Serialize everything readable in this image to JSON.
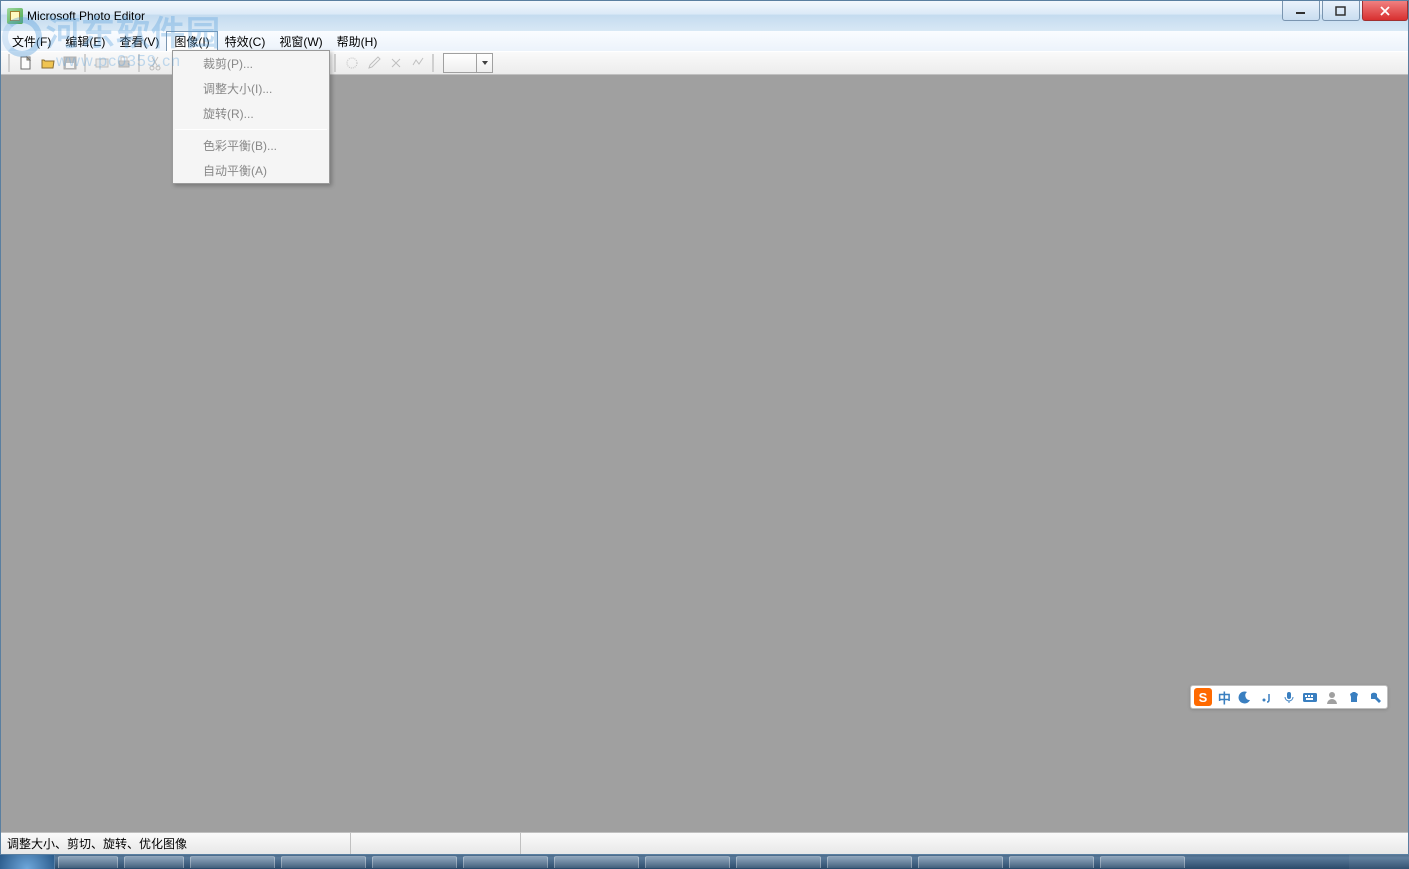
{
  "window": {
    "title": "Microsoft Photo Editor"
  },
  "menu": {
    "file": "文件(F)",
    "edit": "编辑(E)",
    "view": "查看(V)",
    "image": "图像(I)",
    "effects": "特效(C)",
    "window": "视窗(W)",
    "help": "帮助(H)"
  },
  "image_menu": {
    "crop": "裁剪(P)...",
    "resize": "调整大小(I)...",
    "rotate": "旋转(R)...",
    "color_balance": "色彩平衡(B)...",
    "auto_balance": "自动平衡(A)"
  },
  "status": {
    "hint": "调整大小、剪切、旋转、优化图像"
  },
  "watermark": {
    "text": "河东软件园",
    "url": "www.pc0359.cn"
  },
  "ime": {
    "logo": "S",
    "lang": "中"
  }
}
